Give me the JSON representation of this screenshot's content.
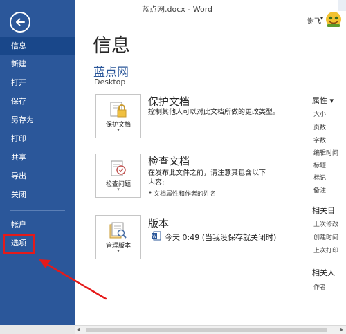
{
  "window": {
    "title": "蓝点网.docx - Word",
    "user_name": "谢飞",
    "user_caret": "▾"
  },
  "nav": {
    "back_icon": "back-arrow-icon",
    "items": [
      {
        "label": "信息"
      },
      {
        "label": "新建"
      },
      {
        "label": "打开"
      },
      {
        "label": "保存"
      },
      {
        "label": "另存为"
      },
      {
        "label": "打印"
      },
      {
        "label": "共享"
      },
      {
        "label": "导出"
      },
      {
        "label": "关闭"
      },
      {
        "label": "帐户"
      },
      {
        "label": "选项"
      }
    ]
  },
  "main": {
    "page_title": "信息",
    "doc_name": "蓝点网",
    "doc_path": "Desktop",
    "protect": {
      "button_label": "保护文档",
      "title": "保护文档",
      "description": "控制其他人可以对此文档所做的更改类型。"
    },
    "inspect": {
      "button_label": "检查问题",
      "title": "检查文档",
      "description_line1": "在发布此文件之前，请注意其包含以下",
      "description_line2": "内容:",
      "bullet": "文档属性和作者的姓名"
    },
    "versions": {
      "button_label": "管理版本",
      "title": "版本",
      "entry": "今天 0:49 (当我没保存就关闭时)"
    },
    "dropdown_caret": "▾"
  },
  "properties": {
    "header": "属性 ▾",
    "items": [
      "大小",
      "页数",
      "字数",
      "编辑时间",
      "标题",
      "标记",
      "备注"
    ],
    "dates_header": "相关日",
    "dates": [
      "上次修改",
      "创建时间",
      "上次打印"
    ],
    "people_header": "相关人",
    "people": [
      "作者"
    ]
  },
  "scrollbar": {
    "left_arrow": "◂",
    "right_arrow": "▸"
  },
  "colors": {
    "sidebar": "#2b579a",
    "sidebar_active": "#19478a",
    "accent_text": "#2b579a",
    "highlight": "#e51a1a"
  }
}
